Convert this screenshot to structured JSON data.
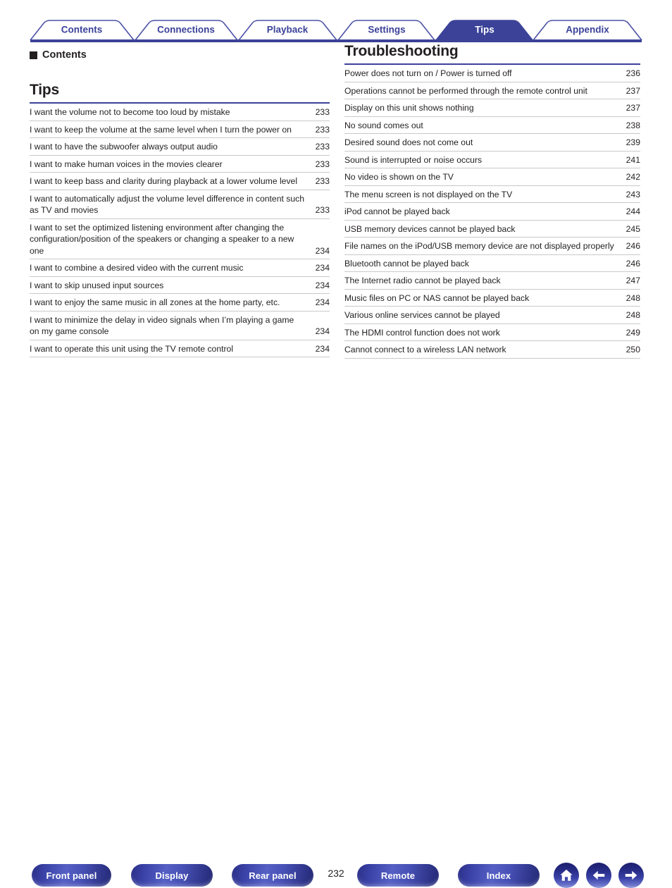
{
  "tabs": [
    {
      "label": "Contents",
      "active": false
    },
    {
      "label": "Connections",
      "active": false
    },
    {
      "label": "Playback",
      "active": false
    },
    {
      "label": "Settings",
      "active": false
    },
    {
      "label": "Tips",
      "active": true
    },
    {
      "label": "Appendix",
      "active": false
    }
  ],
  "colors": {
    "accent": "#3b4298",
    "active_tab_fill": "#3b4298",
    "rule": "#3b4298",
    "row_divider": "#c9c9cf",
    "text": "#231f20"
  },
  "left_column": {
    "kicker": "Contents",
    "section_title": "Tips",
    "entries": [
      {
        "title": "I want the volume not to become too loud by mistake",
        "page": "233"
      },
      {
        "title": "I want to keep the volume at the same level when I turn the power on",
        "page": "233"
      },
      {
        "title": "I want to have the subwoofer always output audio",
        "page": "233"
      },
      {
        "title": "I want to make human voices in the movies clearer",
        "page": "233"
      },
      {
        "title": "I want to keep bass and clarity during playback at a lower volume level",
        "page": "233"
      },
      {
        "title": "I want to automatically adjust the volume level difference in content such as TV and movies",
        "page": "233"
      },
      {
        "title": "I want to set the optimized listening environment after changing the configuration/position of the speakers or changing a speaker to a new one",
        "page": "234"
      },
      {
        "title": "I want to combine a desired video with the current music",
        "page": "234"
      },
      {
        "title": "I want to skip unused input sources",
        "page": "234"
      },
      {
        "title": "I want to enjoy the same music in all zones at the home party, etc.",
        "page": "234"
      },
      {
        "title": "I want to minimize the delay in video signals when I’m playing a game on my game console",
        "page": "234"
      },
      {
        "title": "I want to operate this unit using the TV remote control",
        "page": "234"
      }
    ]
  },
  "right_column": {
    "section_title": "Troubleshooting",
    "entries": [
      {
        "title": "Power does not turn on / Power is turned off",
        "page": "236"
      },
      {
        "title": "Operations cannot be performed through the remote control unit",
        "page": "237"
      },
      {
        "title": "Display on this unit shows nothing",
        "page": "237"
      },
      {
        "title": "No sound comes out",
        "page": "238"
      },
      {
        "title": "Desired sound does not come out",
        "page": "239"
      },
      {
        "title": "Sound is interrupted or noise occurs",
        "page": "241"
      },
      {
        "title": "No video is shown on the TV",
        "page": "242"
      },
      {
        "title": "The menu screen is not displayed on the TV",
        "page": "243"
      },
      {
        "title": "iPod cannot be played back",
        "page": "244"
      },
      {
        "title": "USB memory devices cannot be played back",
        "page": "245"
      },
      {
        "title": "File names on the iPod/USB memory device are not displayed properly",
        "page": "246"
      },
      {
        "title": "Bluetooth cannot be played back",
        "page": "246"
      },
      {
        "title": "The Internet radio cannot be played back",
        "page": "247"
      },
      {
        "title": "Music files on PC or NAS cannot be played back",
        "page": "248"
      },
      {
        "title": "Various online services cannot be played",
        "page": "248"
      },
      {
        "title": "The HDMI control function does not work",
        "page": "249"
      },
      {
        "title": "Cannot connect to a wireless LAN network",
        "page": "250"
      }
    ]
  },
  "footer": {
    "page_number": "232",
    "buttons": [
      {
        "label": "Front panel"
      },
      {
        "label": "Display"
      },
      {
        "label": "Rear panel"
      },
      {
        "label": "Remote"
      },
      {
        "label": "Index"
      }
    ],
    "icons": [
      {
        "name": "home-icon"
      },
      {
        "name": "arrow-left-icon"
      },
      {
        "name": "arrow-right-icon"
      }
    ]
  }
}
